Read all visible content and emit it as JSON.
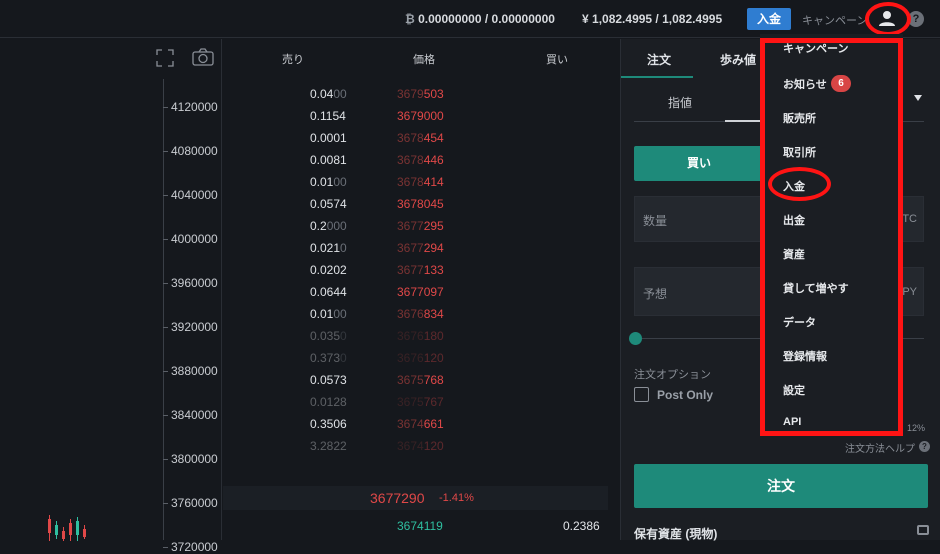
{
  "topbar": {
    "btc_icon": "₿",
    "btc_balance": "0.00000000 / 0.00000000",
    "jpy_symbol": "¥",
    "jpy_balance": "1,082.4995 / 1,082.4995",
    "deposit_label": "入金",
    "campaign_label": "キャンペーン",
    "help_glyph": "?",
    "user_icon": "user-icon"
  },
  "chart": {
    "y_ticks": [
      "4120000",
      "4080000",
      "4040000",
      "4000000",
      "3960000",
      "3920000",
      "3880000",
      "3840000",
      "3800000",
      "3760000",
      "3720000"
    ],
    "toolbar_icons": [
      "fullscreen-icon",
      "camera-icon"
    ]
  },
  "orderbook": {
    "headers": {
      "sell": "売り",
      "price": "価格",
      "buy": "買い"
    },
    "asks": [
      {
        "size_main": "0.04",
        "size_dim": "00",
        "price_dim": "3679",
        "price_main": "503",
        "faded": false
      },
      {
        "size_main": "0.1154",
        "size_dim": "",
        "price_dim": "",
        "price_main": "3679000",
        "faded": false
      },
      {
        "size_main": "0.0001",
        "size_dim": "",
        "price_dim": "3678",
        "price_main": "454",
        "faded": false
      },
      {
        "size_main": "0.0081",
        "size_dim": "",
        "price_dim": "3678",
        "price_main": "446",
        "faded": false
      },
      {
        "size_main": "0.01",
        "size_dim": "00",
        "price_dim": "3678",
        "price_main": "414",
        "faded": false
      },
      {
        "size_main": "0.0574",
        "size_dim": "",
        "price_dim": "",
        "price_main": "3678045",
        "faded": false
      },
      {
        "size_main": "0.2",
        "size_dim": "000",
        "price_dim": "3677",
        "price_main": "295",
        "faded": false
      },
      {
        "size_main": "0.021",
        "size_dim": "0",
        "price_dim": "3677",
        "price_main": "294",
        "faded": false
      },
      {
        "size_main": "0.0202",
        "size_dim": "",
        "price_dim": "3677",
        "price_main": "133",
        "faded": false
      },
      {
        "size_main": "0.0644",
        "size_dim": "",
        "price_dim": "",
        "price_main": "3677097",
        "faded": false
      },
      {
        "size_main": "0.01",
        "size_dim": "00",
        "price_dim": "3676",
        "price_main": "834",
        "faded": false
      },
      {
        "size_main": "0.035",
        "size_dim": "0",
        "price_dim": "3676",
        "price_main": "180",
        "faded": true
      },
      {
        "size_main": "0.373",
        "size_dim": "0",
        "price_dim": "3676",
        "price_main": "120",
        "faded": true
      },
      {
        "size_main": "0.0573",
        "size_dim": "",
        "price_dim": "3675",
        "price_main": "768",
        "faded": false
      },
      {
        "size_main": "0.0128",
        "size_dim": "",
        "price_dim": "3675",
        "price_main": "767",
        "faded": true
      },
      {
        "size_main": "0.3506",
        "size_dim": "",
        "price_dim": "3674",
        "price_main": "661",
        "faded": false
      },
      {
        "size_main": "3.2822",
        "size_dim": "",
        "price_dim": "3674",
        "price_main": "120",
        "faded": true
      }
    ],
    "last_price": "3677290",
    "change_pct": "-1.41%",
    "bid_price": "3674119",
    "bid_size": "0.2386"
  },
  "order_panel": {
    "tabs": [
      "注文",
      "歩み値"
    ],
    "sub_tabs": [
      "指値"
    ],
    "buy_label": "買い",
    "quantity_label": "数量",
    "quantity_unit": "TC",
    "estimate_label": "予想",
    "estimate_unit": "PY",
    "options_label": "注文オプション",
    "post_only_label": "Post Only",
    "fee_pct": "12%",
    "help_link": "注文方法ヘルプ",
    "submit_label": "注文",
    "assets_title": "保有資産 (現物)"
  },
  "user_menu": {
    "items": [
      "キャンペーン",
      "お知らせ",
      "販売所",
      "取引所",
      "入金",
      "出金",
      "資産",
      "貸して増やす",
      "データ",
      "登録情報",
      "設定",
      "API"
    ],
    "notification_count": "6"
  },
  "colors": {
    "background": "#15181d",
    "accent_teal": "#1e8a7a",
    "ask_red": "#e04848",
    "bid_green": "#2fbfa0",
    "deposit_blue": "#2f7dd1",
    "highlight_red": "#ff1414"
  }
}
